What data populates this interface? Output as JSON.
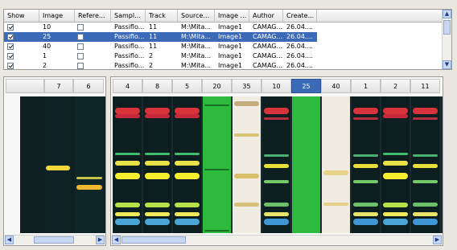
{
  "table": {
    "columns": [
      {
        "label": "Show"
      },
      {
        "label": "Image"
      },
      {
        "label": "Refere..."
      },
      {
        "label": "Sampl..."
      },
      {
        "label": "Track"
      },
      {
        "label": "Source..."
      },
      {
        "label": "Image ..."
      },
      {
        "label": "Author"
      },
      {
        "label": "Create..."
      }
    ],
    "rows": [
      {
        "show": true,
        "image": "10",
        "reference": false,
        "sample": "Passiflo...",
        "track": "11",
        "source": "M:\\Mita...",
        "image_name": "Image1",
        "author": "CAMAG...",
        "created": "26.04....",
        "selected": false
      },
      {
        "show": true,
        "image": "25",
        "reference": false,
        "sample": "Passiflo...",
        "track": "11",
        "source": "M:\\Mita...",
        "image_name": "Image1",
        "author": "CAMAG...",
        "created": "26.04....",
        "selected": true
      },
      {
        "show": true,
        "image": "40",
        "reference": false,
        "sample": "Passiflo...",
        "track": "11",
        "source": "M:\\Mita...",
        "image_name": "Image1",
        "author": "CAMAG...",
        "created": "26.04....",
        "selected": false
      },
      {
        "show": true,
        "image": "1",
        "reference": false,
        "sample": "Passiflo...",
        "track": "2",
        "source": "M:\\Mita...",
        "image_name": "Image1",
        "author": "CAMAG...",
        "created": "26.04....",
        "selected": false
      },
      {
        "show": true,
        "image": "2",
        "reference": false,
        "sample": "Passiflo...",
        "track": "2",
        "source": "M:\\Mita...",
        "image_name": "Image1",
        "author": "CAMAG...",
        "created": "26.04....",
        "selected": false
      }
    ]
  },
  "left_panel": {
    "tracks": [
      "7",
      "6"
    ]
  },
  "right_panel": {
    "tracks": [
      "4",
      "8",
      "5",
      "20",
      "35",
      "10",
      "25",
      "40",
      "1",
      "2",
      "11"
    ],
    "selected_track": "25"
  },
  "icons": {
    "scroll_up": "scroll-up-icon",
    "scroll_down": "scroll-down-icon",
    "scroll_left": "scroll-left-icon",
    "scroll_right": "scroll-right-icon"
  },
  "colors": {
    "selection": "#3a6ab8",
    "plate_dark": "#0f1f22",
    "plate_green": "#2dbb3d",
    "plate_white": "#f1ece2"
  }
}
